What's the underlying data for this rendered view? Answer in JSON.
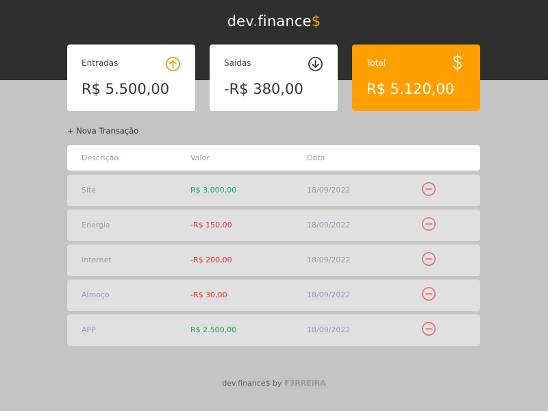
{
  "app": {
    "logo_part1": "dev",
    "logo_dot": ".",
    "logo_part2": "finance",
    "logo_dollar": "$"
  },
  "cards": {
    "income": {
      "label": "Entradas",
      "value": "R$ 5.500,00",
      "icon": "arrow-up-circle-icon"
    },
    "expense": {
      "label": "Saídas",
      "value": "-R$ 380,00",
      "icon": "arrow-down-circle-icon"
    },
    "total": {
      "label": "Total",
      "value": "R$ 5.120,00",
      "icon": "dollar-sign-icon"
    }
  },
  "new_transaction_label": "+ Nova Transação",
  "table": {
    "headers": {
      "description": "Descrição",
      "value": "Valor",
      "date": "Data"
    },
    "rows": [
      {
        "description": "Site",
        "value": "R$ 3.000,00",
        "date": "18/09/2022",
        "type": "income"
      },
      {
        "description": "Energia",
        "value": "-R$ 150,00",
        "date": "18/09/2022",
        "type": "expense"
      },
      {
        "description": "Internet",
        "value": "-R$ 200,00",
        "date": "18/09/2022",
        "type": "expense"
      },
      {
        "description": "Almoço",
        "value": "-R$ 30,00",
        "date": "18/09/2022",
        "type": "expense"
      },
      {
        "description": "APP",
        "value": "R$ 2.500,00",
        "date": "18/09/2022",
        "type": "income"
      }
    ]
  },
  "footer": {
    "text": "dev.finance$ by",
    "author": "F3RREIRA"
  },
  "colors": {
    "header_bg": "#2f2f2f",
    "accent": "#f0a500",
    "total_card": "#ff9f00",
    "income": "#12a454",
    "expense": "#e92929"
  }
}
